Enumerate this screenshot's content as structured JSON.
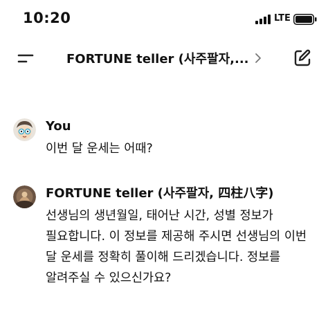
{
  "status_bar": {
    "time": "10:20",
    "network": "LTE"
  },
  "header": {
    "title": "FORTUNE teller (사주팔자,...",
    "icons": [
      "menu-icon",
      "chevron-right-icon",
      "compose-icon"
    ]
  },
  "messages": [
    {
      "sender": "You",
      "text": "이번 달 운세는 어때?"
    },
    {
      "sender": "FORTUNE teller (사주팔자, 四柱八字)",
      "text": "선생님의 생년월일, 태어난 시간, 성별 정보가 필요합니다. 이 정보를 제공해 주시면 선생님의 이번 달 운세를 정확히 풀이해 드리겠습니다. 정보를 알려주실 수 있으신가요?"
    }
  ],
  "colors": {
    "background": "#ffffff",
    "text": "#111111",
    "icon": "#222222"
  }
}
